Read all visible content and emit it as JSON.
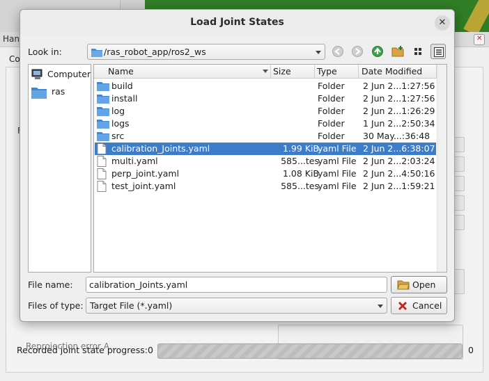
{
  "background_window": {
    "title": "Han",
    "tab_label": "Co",
    "side_label": "F",
    "reprojection_label": "Reprojection error A..."
  },
  "progress": {
    "label": "Recorded joint state progress:",
    "current": "0",
    "total": "0",
    "fraction": 0
  },
  "dialog": {
    "title": "Load Joint States",
    "look_in_label": "Look in:",
    "look_in_path": "/ras_robot_app/ros2_ws",
    "toolbar": {
      "back_icon": "back-arrow-icon",
      "forward_icon": "forward-arrow-icon",
      "parent_icon": "up-arrow-icon",
      "new_folder_icon": "new-folder-icon",
      "list_view_icon": "icon-view-icon",
      "detail_view_icon": "detail-view-icon"
    },
    "places": [
      {
        "label": "Computer",
        "icon": "computer-icon"
      },
      {
        "label": "ras",
        "icon": "folder-icon"
      }
    ],
    "columns": {
      "name": "Name",
      "size": "Size",
      "type": "Type",
      "date": "Date Modified"
    },
    "files": [
      {
        "name": "build",
        "size": "",
        "type": "Folder",
        "date": "2 Jun 2...1:27:56",
        "icon": "folder-icon"
      },
      {
        "name": "install",
        "size": "",
        "type": "Folder",
        "date": "2 Jun 2...1:27:56",
        "icon": "folder-icon"
      },
      {
        "name": "log",
        "size": "",
        "type": "Folder",
        "date": "2 Jun 2...1:26:29",
        "icon": "folder-icon"
      },
      {
        "name": "logs",
        "size": "",
        "type": "Folder",
        "date": "1 Jun 2...2:50:34",
        "icon": "folder-icon"
      },
      {
        "name": "src",
        "size": "",
        "type": "Folder",
        "date": "30 May...:36:48",
        "icon": "folder-icon"
      },
      {
        "name": "calibration_Joints.yaml",
        "size": "1.99 KiB",
        "type": "yaml File",
        "date": "2 Jun 2...6:38:07",
        "icon": "file-icon",
        "selected": true
      },
      {
        "name": "multi.yaml",
        "size": "585...tes",
        "type": "yaml File",
        "date": "2 Jun 2...2:03:24",
        "icon": "file-icon"
      },
      {
        "name": "perp_joint.yaml",
        "size": "1.08 KiB",
        "type": "yaml File",
        "date": "2 Jun 2...4:50:16",
        "icon": "file-icon"
      },
      {
        "name": "test_joint.yaml",
        "size": "585...tes",
        "type": "yaml File",
        "date": "2 Jun 2...1:59:21",
        "icon": "file-icon"
      }
    ],
    "file_name_label": "File name:",
    "file_name_value": "calibration_Joints.yaml",
    "file_type_label": "Files of type:",
    "file_type_value": "Target File (*.yaml)",
    "open_label": "Open",
    "cancel_label": "Cancel",
    "colors": {
      "selection": "#3d7cc9",
      "folder": "#4a90d9",
      "up_arrow": "#3aa24a"
    }
  }
}
